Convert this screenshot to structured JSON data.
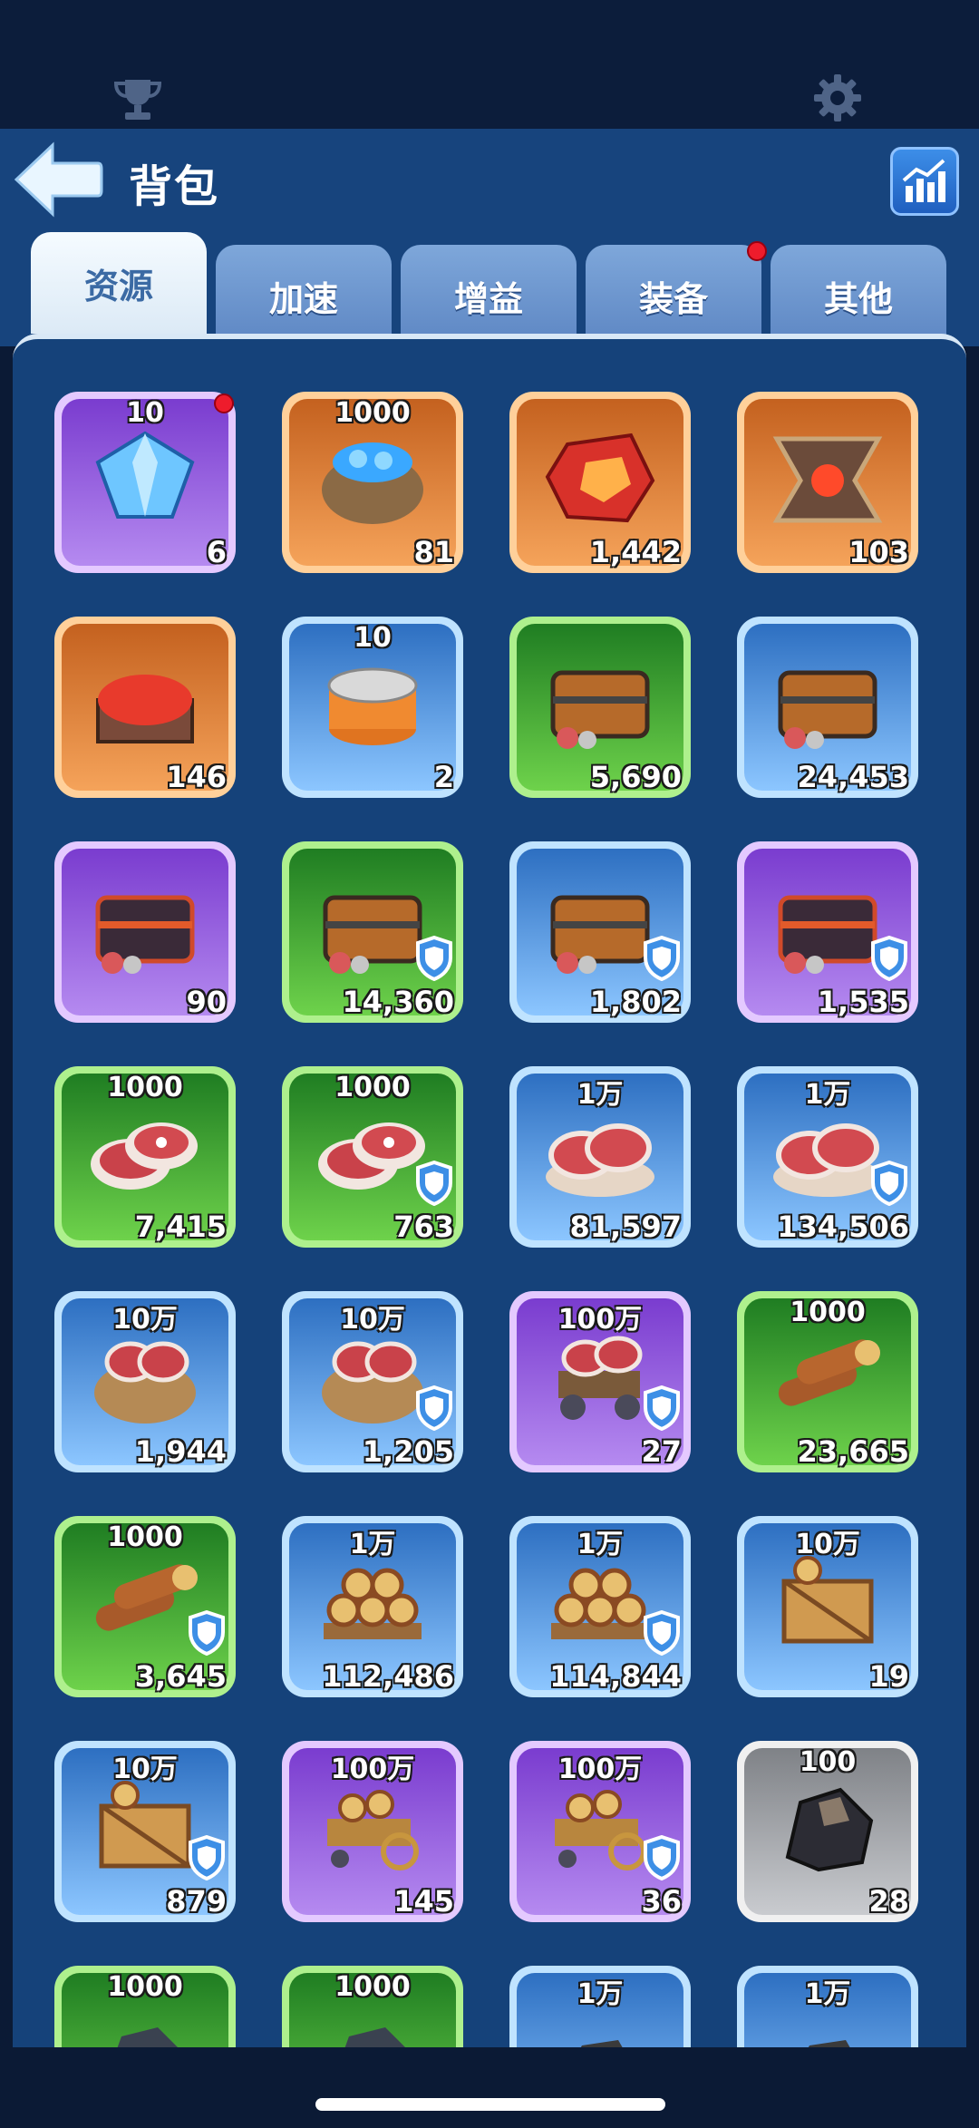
{
  "header": {
    "title": "背包"
  },
  "tabs": [
    {
      "label": "资源",
      "active": true,
      "dot": false
    },
    {
      "label": "加速",
      "active": false,
      "dot": false
    },
    {
      "label": "增益",
      "active": false,
      "dot": false
    },
    {
      "label": "装备",
      "active": false,
      "dot": true
    },
    {
      "label": "其他",
      "active": false,
      "dot": false
    }
  ],
  "items": [
    {
      "denom": "10",
      "count": "6",
      "rarity": "purple",
      "icon": "diamond-icon",
      "shield": false,
      "dot": true
    },
    {
      "denom": "1000",
      "count": "81",
      "rarity": "orange",
      "icon": "diamond-sack-icon",
      "shield": false,
      "dot": false
    },
    {
      "denom": "",
      "count": "1,442",
      "rarity": "orange",
      "icon": "red-crystal-icon",
      "shield": false,
      "dot": false
    },
    {
      "denom": "",
      "count": "103",
      "rarity": "orange",
      "icon": "red-core-frame-icon",
      "shield": false,
      "dot": false
    },
    {
      "denom": "",
      "count": "146",
      "rarity": "orange",
      "icon": "red-ore-crate-icon",
      "shield": false,
      "dot": false
    },
    {
      "denom": "10",
      "count": "2",
      "rarity": "blue",
      "icon": "canned-food-icon",
      "shield": false,
      "dot": false
    },
    {
      "denom": "",
      "count": "5,690",
      "rarity": "green",
      "icon": "resource-chest-icon",
      "shield": false,
      "dot": false
    },
    {
      "denom": "",
      "count": "24,453",
      "rarity": "blue",
      "icon": "resource-chest-icon",
      "shield": false,
      "dot": false
    },
    {
      "denom": "",
      "count": "90",
      "rarity": "purple",
      "icon": "dark-chest-icon",
      "shield": false,
      "dot": false
    },
    {
      "denom": "",
      "count": "14,360",
      "rarity": "green",
      "icon": "resource-chest-icon",
      "shield": true,
      "dot": false
    },
    {
      "denom": "",
      "count": "1,802",
      "rarity": "blue",
      "icon": "resource-chest-icon",
      "shield": true,
      "dot": false
    },
    {
      "denom": "",
      "count": "1,535",
      "rarity": "purple",
      "icon": "dark-chest-icon",
      "shield": true,
      "dot": false
    },
    {
      "denom": "1000",
      "count": "7,415",
      "rarity": "green",
      "icon": "meat-icon",
      "shield": false,
      "dot": false
    },
    {
      "denom": "1000",
      "count": "763",
      "rarity": "green",
      "icon": "meat-icon",
      "shield": true,
      "dot": false
    },
    {
      "denom": "1万",
      "count": "81,597",
      "rarity": "blue",
      "icon": "meat-plate-icon",
      "shield": false,
      "dot": false
    },
    {
      "denom": "1万",
      "count": "134,506",
      "rarity": "blue",
      "icon": "meat-plate-icon",
      "shield": true,
      "dot": false
    },
    {
      "denom": "10万",
      "count": "1,944",
      "rarity": "blue",
      "icon": "meat-sack-icon",
      "shield": false,
      "dot": false
    },
    {
      "denom": "10万",
      "count": "1,205",
      "rarity": "blue",
      "icon": "meat-sack-icon",
      "shield": true,
      "dot": false
    },
    {
      "denom": "100万",
      "count": "27",
      "rarity": "purple",
      "icon": "meat-cart-icon",
      "shield": true,
      "dot": false
    },
    {
      "denom": "1000",
      "count": "23,665",
      "rarity": "green",
      "icon": "logs-icon",
      "shield": false,
      "dot": false
    },
    {
      "denom": "1000",
      "count": "3,645",
      "rarity": "green",
      "icon": "logs-icon",
      "shield": true,
      "dot": false
    },
    {
      "denom": "1万",
      "count": "112,486",
      "rarity": "blue",
      "icon": "log-pile-icon",
      "shield": false,
      "dot": false
    },
    {
      "denom": "1万",
      "count": "114,844",
      "rarity": "blue",
      "icon": "log-pile-icon",
      "shield": true,
      "dot": false
    },
    {
      "denom": "10万",
      "count": "19",
      "rarity": "blue",
      "icon": "wood-crate-icon",
      "shield": false,
      "dot": false
    },
    {
      "denom": "10万",
      "count": "879",
      "rarity": "blue",
      "icon": "wood-crate-icon",
      "shield": true,
      "dot": false
    },
    {
      "denom": "100万",
      "count": "145",
      "rarity": "purple",
      "icon": "wood-cart-icon",
      "shield": false,
      "dot": false
    },
    {
      "denom": "100万",
      "count": "36",
      "rarity": "purple",
      "icon": "wood-cart-icon",
      "shield": true,
      "dot": false
    },
    {
      "denom": "100",
      "count": "28",
      "rarity": "gray",
      "icon": "coal-icon",
      "shield": false,
      "dot": false
    },
    {
      "denom": "1000",
      "count": "",
      "rarity": "green",
      "icon": "ore-icon",
      "shield": false,
      "dot": false
    },
    {
      "denom": "1000",
      "count": "",
      "rarity": "green",
      "icon": "ore-icon",
      "shield": false,
      "dot": false
    },
    {
      "denom": "1万",
      "count": "",
      "rarity": "blue",
      "icon": "ore-pile-icon",
      "shield": false,
      "dot": false
    },
    {
      "denom": "1万",
      "count": "",
      "rarity": "blue",
      "icon": "ore-pile-icon",
      "shield": false,
      "dot": false
    }
  ]
}
